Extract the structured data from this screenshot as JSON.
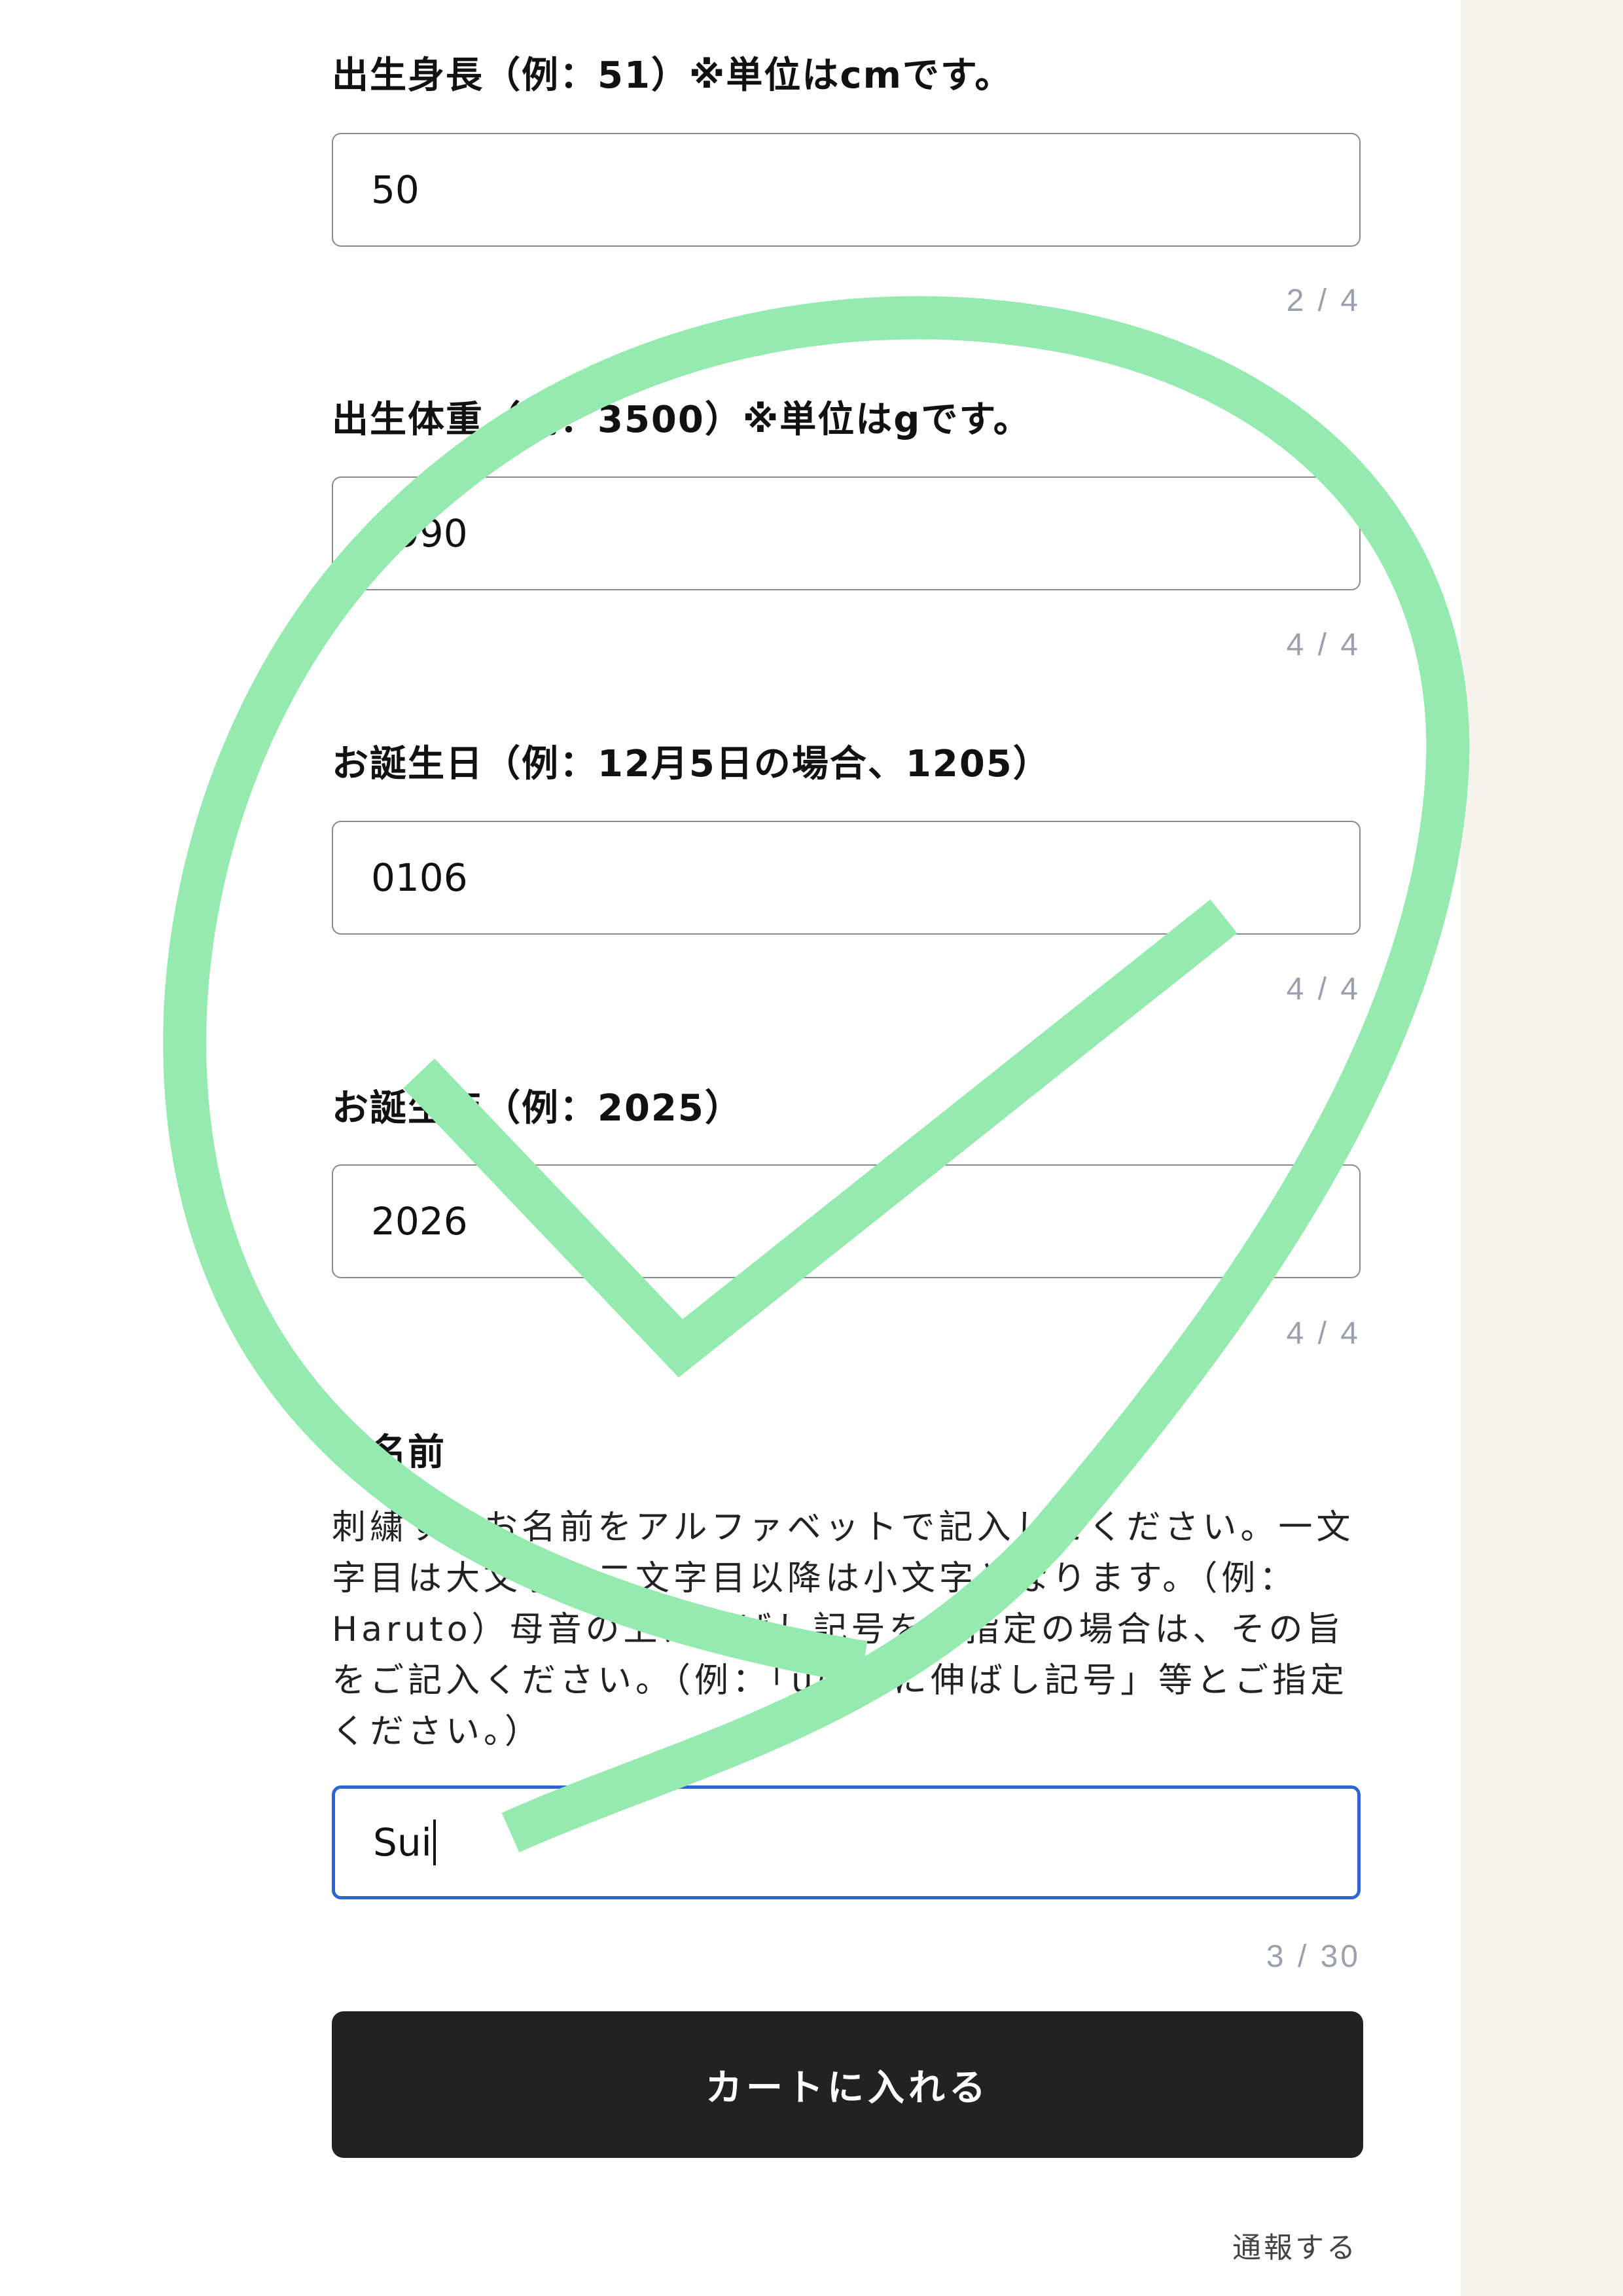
{
  "fields": [
    {
      "label": "出生身長（例：51）※単位はcmです。",
      "value": "50",
      "counter": "2 / 4"
    },
    {
      "label": "出生体重（例：3500）※単位はgです。",
      "value": "2990",
      "counter": "4 / 4"
    },
    {
      "label": "お誕生日（例：12月5日の場合、1205）",
      "value": "0106",
      "counter": "4 / 4"
    },
    {
      "label": "お誕生年（例：2025）",
      "value": "2026",
      "counter": "4 / 4"
    }
  ],
  "name_field": {
    "label": "お名前",
    "description": "刺繍するお名前をアルファベットで記入してください。一文字目は大文字、二文字目以降は小文字となります。（例：Haruto）母音の上に伸ばし記号をご指定の場合は、その旨をご記入ください。（例：「uの上に伸ばし記号」等とご指定ください。）",
    "value": "Sui",
    "counter": "3 / 30"
  },
  "cart_button_label": "カートに入れる",
  "report_link_label": "通報する",
  "overlay": {
    "icon": "checkmark-circle-icon",
    "color": "#95eab0"
  },
  "colors": {
    "focus_border": "#2d66d1",
    "button_bg": "#222222",
    "side_panel": "#f6f3ee"
  }
}
